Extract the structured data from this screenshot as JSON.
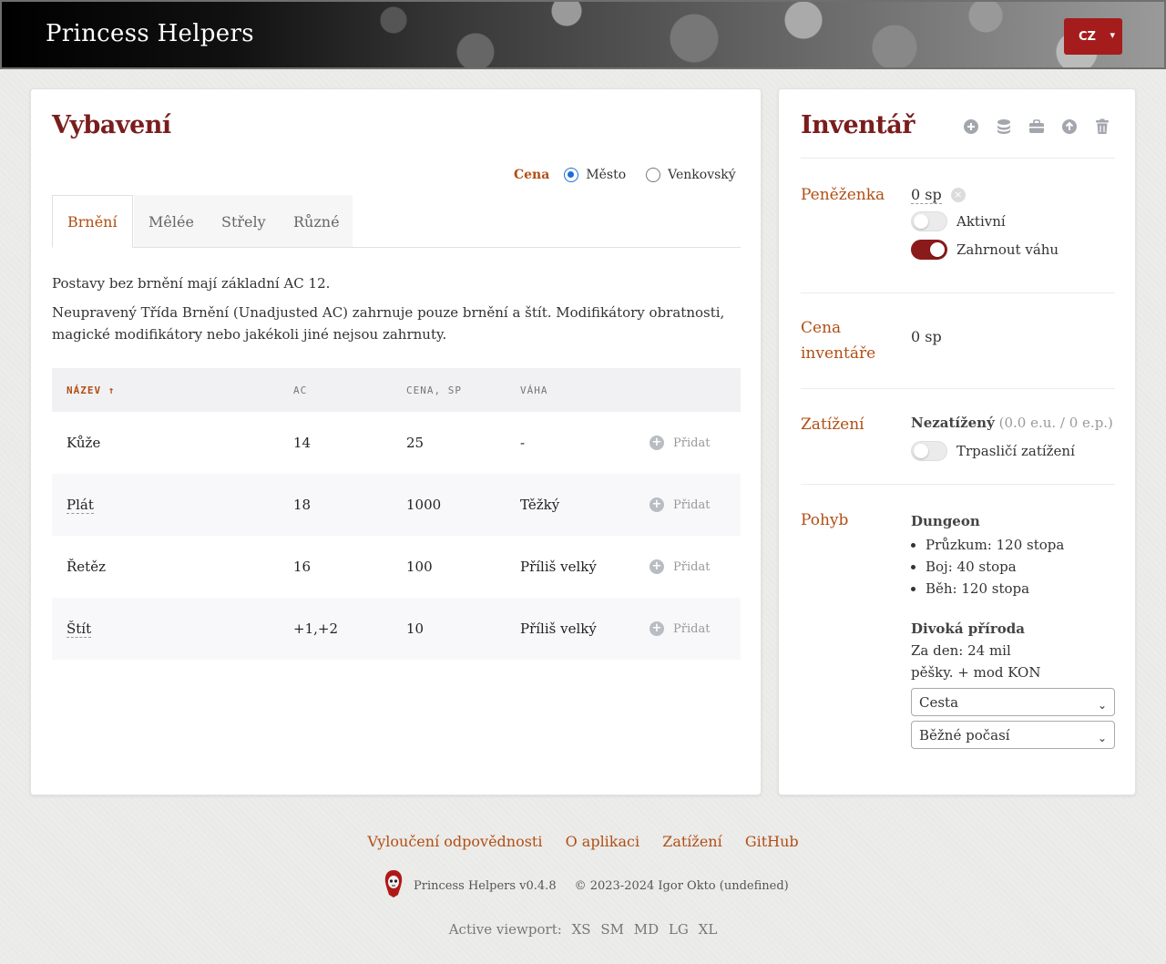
{
  "header": {
    "brand": "Princess Helpers",
    "lang": "CZ"
  },
  "equipment": {
    "title": "Vybavení",
    "price": {
      "label": "Cena",
      "options": [
        "Město",
        "Venkovský"
      ],
      "selected": "Město"
    },
    "tabs": [
      "Brnění",
      "Mêlée",
      "Střely",
      "Různé"
    ],
    "active_tab": "Brnění",
    "notes": [
      "Postavy bez brnění mají základní AC 12.",
      "Neupravený Třída Brnění (Unadjusted AC) zahrnuje pouze brnění a štít. Modifikátory obratnosti, magické modifikátory nebo jakékoli jiné nejsou zahrnuty."
    ],
    "columns": [
      "NÁZEV ↑",
      "AC",
      "CENA, SP",
      "VÁHA"
    ],
    "add_label": "Přidat",
    "rows": [
      {
        "name": "Kůže",
        "ac": "14",
        "cost": "25",
        "weight": "-"
      },
      {
        "name": "Plát",
        "ac": "18",
        "cost": "1000",
        "weight": "Těžký"
      },
      {
        "name": "Řetěz",
        "ac": "16",
        "cost": "100",
        "weight": "Příliš velký"
      },
      {
        "name": "Štít",
        "ac": "+1,+2",
        "cost": "10",
        "weight": "Příliš velký"
      }
    ]
  },
  "inventory": {
    "title": "Inventář",
    "icons": [
      "plus-circle-icon",
      "coins-icon",
      "briefcase-icon",
      "arrow-up-circle-icon",
      "trash-icon"
    ],
    "wallet": {
      "label": "Peněženka",
      "value": "0 sp",
      "active_label": "Aktivní",
      "active": false,
      "weight_label": "Zahrnout váhu",
      "weight": true
    },
    "inv_cost": {
      "label": "Cena inventáře",
      "value": "0 sp"
    },
    "encumbrance": {
      "label": "Zatížení",
      "status": "Nezatížený",
      "detail": "(0.0 e.u. / 0 e.p.)",
      "dwarf_label": "Trpasličí zatížení",
      "dwarf": false
    },
    "movement": {
      "label": "Pohyb",
      "dungeon_title": "Dungeon",
      "dungeon": [
        "Průzkum: 120 stopa",
        "Boj: 40 stopa",
        "Běh: 120 stopa"
      ],
      "wild_title": "Divoká příroda",
      "wild_line1": "Za den: 24 mil",
      "wild_line2": "pěšky. + mod KON",
      "terrain": "Cesta",
      "weather": "Běžné počasí"
    }
  },
  "footer": {
    "links": [
      "Vyloučení odpovědnosti",
      "O aplikaci",
      "Zatížení",
      "GitHub"
    ],
    "version": "Princess Helpers v0.4.8",
    "copyright": "© 2023-2024 Igor Okto (undefined)",
    "viewport_label": "Active viewport:",
    "viewports": [
      "XS",
      "SM",
      "MD",
      "LG",
      "XL"
    ]
  },
  "colors": {
    "accent": "#b14e14",
    "title": "#7a1d1d",
    "toggle_on": "#8b1a1a",
    "lang_bg": "#a51c1c"
  }
}
